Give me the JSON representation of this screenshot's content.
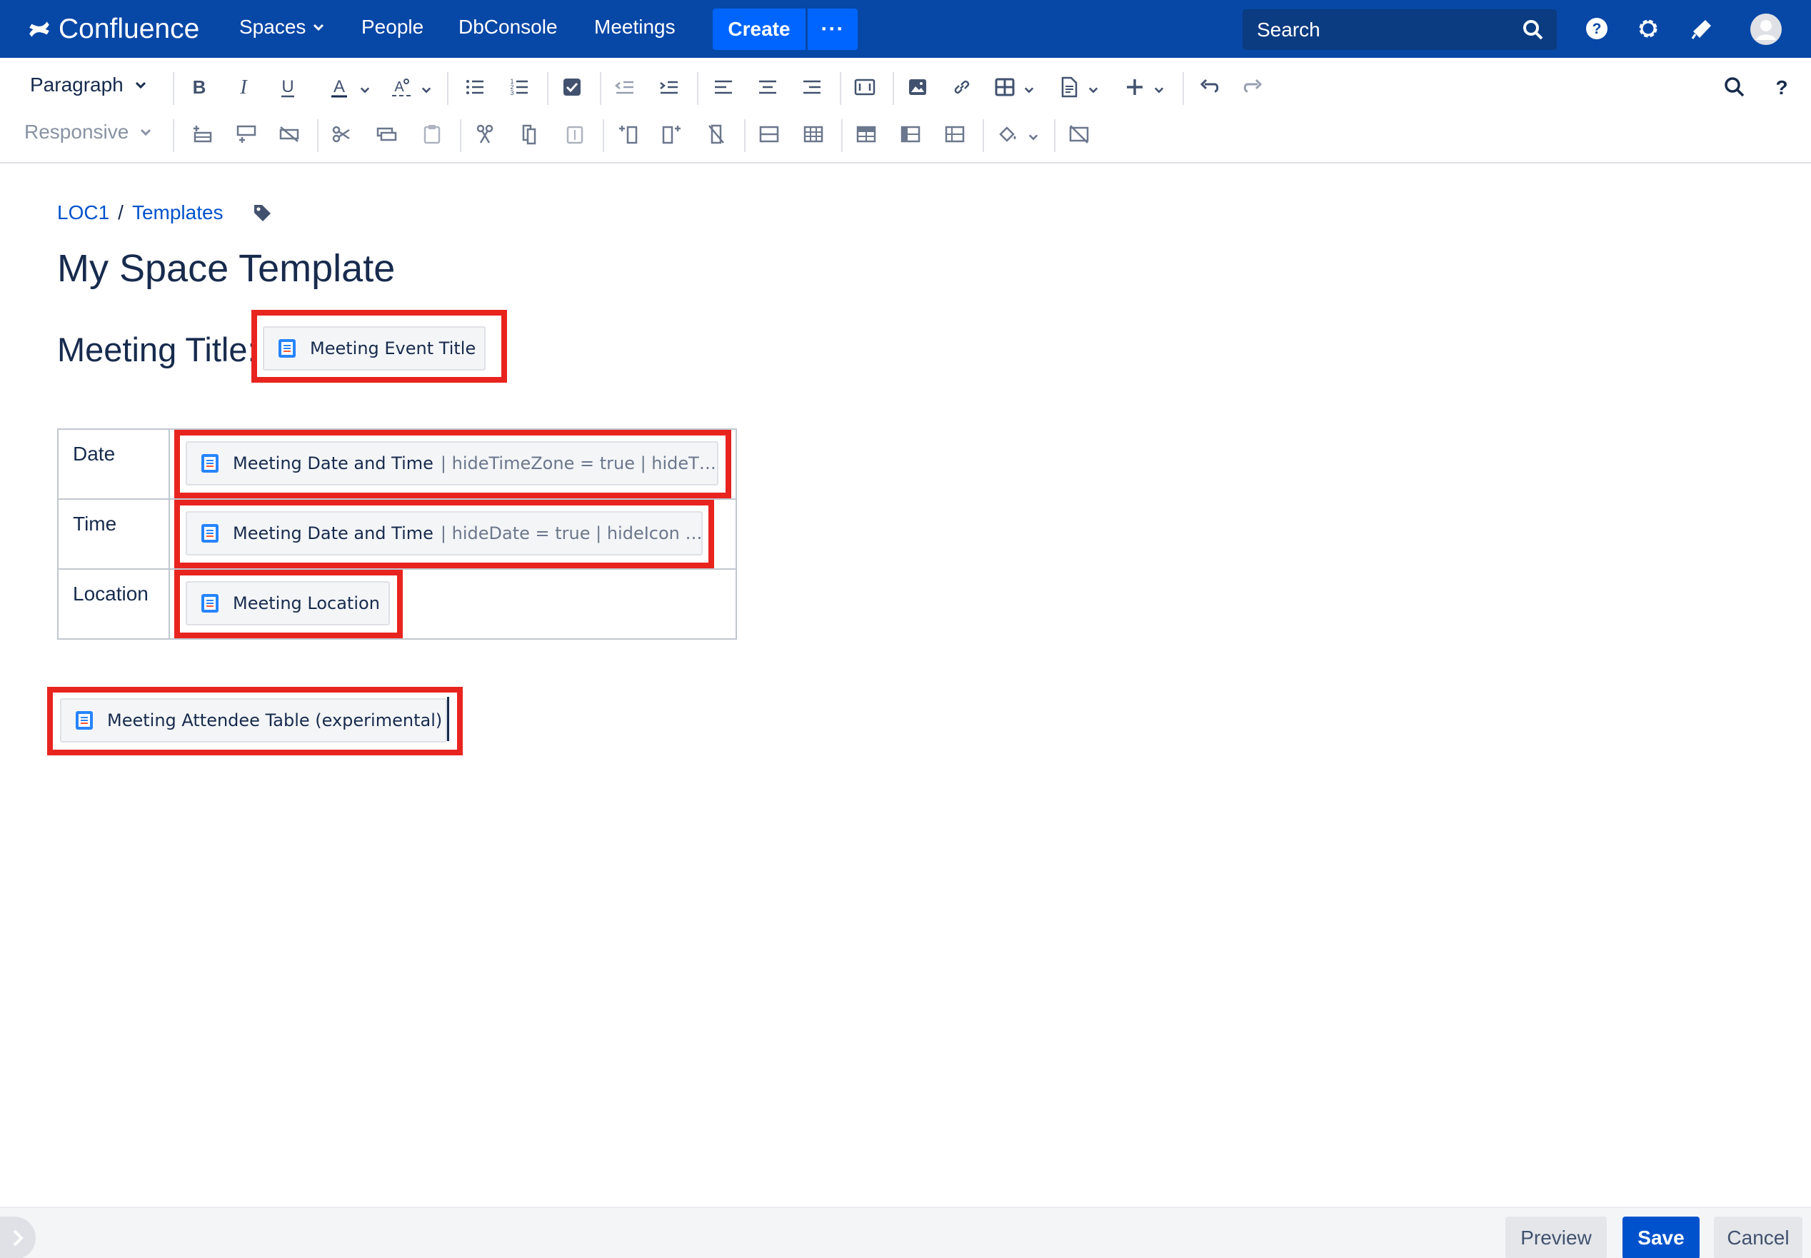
{
  "nav": {
    "logo": "Confluence",
    "items": [
      "Spaces",
      "People",
      "DbConsole",
      "Meetings"
    ],
    "create_label": "Create",
    "more_label": "···",
    "search_placeholder": "Search"
  },
  "toolbar": {
    "paragraph_style": "Paragraph",
    "table_layout": "Responsive"
  },
  "breadcrumb": [
    "LOC1",
    "Templates"
  ],
  "page_title": "My Space Template",
  "meeting_title_label": "Meeting Title:",
  "macros": {
    "event_title": "Meeting Event Title",
    "date": {
      "name": "Meeting Date and Time",
      "params": "| hideTimeZone = true | hideT…"
    },
    "time": {
      "name": "Meeting Date and Time",
      "params": "| hideDate = true | hideIcon …"
    },
    "location": "Meeting Location",
    "attendee_table": "Meeting Attendee Table (experimental)"
  },
  "table": {
    "rows": [
      {
        "label": "Date"
      },
      {
        "label": "Time"
      },
      {
        "label": "Location"
      }
    ]
  },
  "footer": {
    "preview": "Preview",
    "save": "Save",
    "cancel": "Cancel"
  },
  "colors": {
    "nav_bg": "#0747a6",
    "create_btn": "#0065ff",
    "highlight": "#e8241f",
    "save_btn": "#0052cc"
  }
}
